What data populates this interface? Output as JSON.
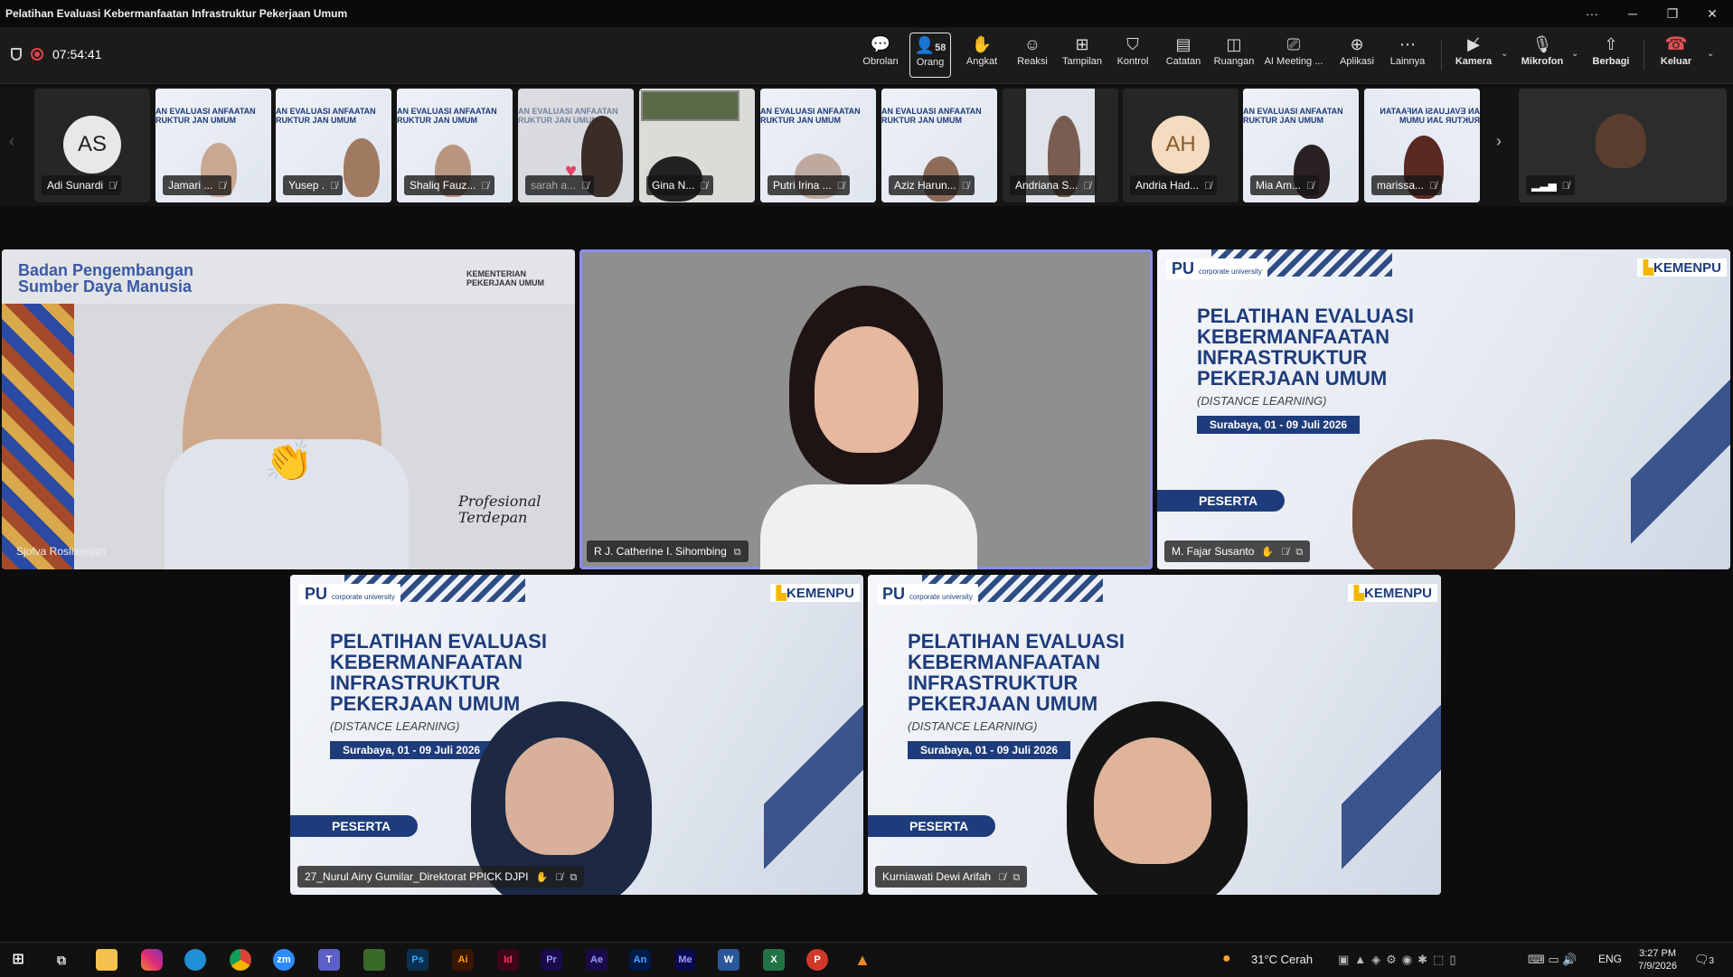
{
  "window": {
    "title": "Pelatihan Evaluasi Kebermanfaatan Infrastruktur Pekerjaan Umum",
    "more": "···",
    "minimize": "─",
    "restore": "❐",
    "close": "✕"
  },
  "meeting": {
    "timer": "07:54:41",
    "people_count": "58"
  },
  "toolbar": {
    "chat": "Obrolan",
    "people": "Orang",
    "raise": "Angkat",
    "react": "Reaksi",
    "view": "Tampilan",
    "control": "Kontrol",
    "notes": "Catatan",
    "rooms": "Ruangan",
    "ai": "AI Meeting ...",
    "apps": "Aplikasi",
    "more": "Lainnya",
    "camera": "Kamera",
    "mic": "Mikrofon",
    "share": "Berbagi",
    "leave": "Keluar"
  },
  "strip": {
    "participants": [
      {
        "name": "Adi Sunardi",
        "initials": "AS"
      },
      {
        "name": "Jamari ..."
      },
      {
        "name": "Yusep ."
      },
      {
        "name": "Shaliq Fauz..."
      },
      {
        "name": "sarah a..."
      },
      {
        "name": "Gina N..."
      },
      {
        "name": "Putri Irina ..."
      },
      {
        "name": "Aziz Harun..."
      },
      {
        "name": "Andriana S..."
      },
      {
        "name": "Andria Had...",
        "initials": "AH"
      },
      {
        "name": "Mia Am..."
      },
      {
        "name": "marissa..."
      }
    ]
  },
  "slide": {
    "title_lines": [
      "PELATIHAN EVALUASI",
      "KEBERMANFAATAN",
      "INFRASTRUKTUR",
      "PEKERJAAN UMUM"
    ],
    "subtitle": "(DISTANCE LEARNING)",
    "date": "Surabaya, 01 - 09 Juli 2026",
    "badge": "PESERTA",
    "pu": "PU",
    "pu_sub": "corporate university",
    "kemenpu": "KEMENPU",
    "mini_title": "AN EVALUASI ANFAATAN RUKTUR JAN UMUM",
    "bpsdm": "Badan Pengembangan Sumber Daya Manusia",
    "kementerian": "KEMENTERIAN PEKERJAAN UMUM",
    "motto": "Profesional Terdepan"
  },
  "tiles": [
    {
      "name": "Sjofva Rosliansjah"
    },
    {
      "name": "R J. Catherine I. Sihombing"
    },
    {
      "name": "M. Fajar Susanto"
    },
    {
      "name": "27_Nurul Ainy Gumilar_Direktorat PPICK DJPI"
    },
    {
      "name": "Kurniawati Dewi Arifah"
    }
  ],
  "taskbar": {
    "weather": "31°C  Cerah",
    "lang": "ENG",
    "time": "3:27 PM",
    "date": "7/9/2026",
    "notifications": "3",
    "apps": [
      "Ps",
      "Ai",
      "Id",
      "Pr",
      "Ae",
      "An",
      "Me"
    ],
    "colors": {
      "ps": "#0b2f4f",
      "ai": "#3a1500",
      "id": "#3d0618",
      "pr": "#1a0a4a",
      "ae": "#1a0a4a",
      "an": "#001a4a",
      "me": "#0a0a4a"
    }
  }
}
